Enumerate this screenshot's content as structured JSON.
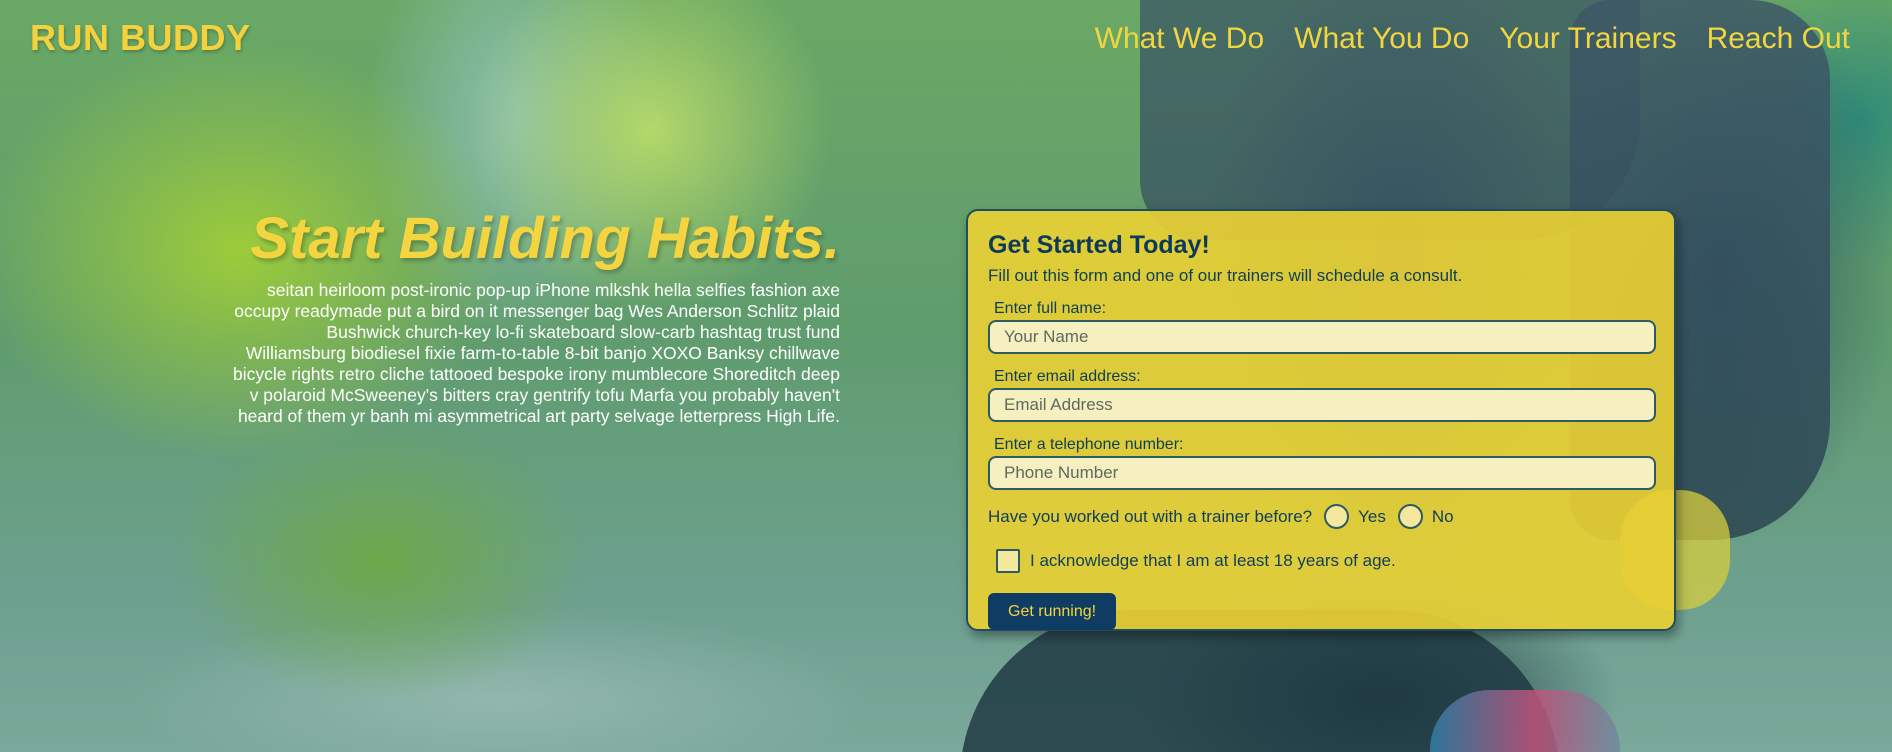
{
  "header": {
    "logo": "RUN BUDDY",
    "nav": [
      {
        "label": "What We Do"
      },
      {
        "label": "What You Do"
      },
      {
        "label": "Your Trainers"
      },
      {
        "label": "Reach Out"
      }
    ]
  },
  "hero": {
    "title": "Start Building Habits.",
    "body_lines": [
      "seitan heirloom post-ironic pop-up iPhone mlkshk hella selfies fashion axe",
      "occupy readymade put a bird on it messenger bag Wes Anderson Schlitz plaid",
      "Bushwick church-key lo-fi skateboard slow-carb hashtag trust fund",
      "Williamsburg biodiesel fixie farm-to-table 8-bit banjo XOXO Banksy chillwave",
      "bicycle rights retro cliche tattooed bespoke irony mumblecore Shoreditch deep",
      "v polaroid McSweeney's bitters cray gentrify tofu Marfa you probably haven't",
      "heard of them yr banh mi asymmetrical art party selvage letterpress High Life."
    ]
  },
  "form": {
    "title": "Get Started Today!",
    "subtitle": "Fill out this form and one of our trainers will schedule a consult.",
    "name": {
      "label": "Enter full name:",
      "placeholder": "Your Name",
      "value": ""
    },
    "email": {
      "label": "Enter email address:",
      "placeholder": "Email Address",
      "value": ""
    },
    "phone": {
      "label": "Enter a telephone number:",
      "placeholder": "Phone Number",
      "value": ""
    },
    "trainer_question": "Have you worked out with a trainer before?",
    "radio_yes": "Yes",
    "radio_no": "No",
    "acknowledge": "I acknowledge that I am at least 18 years of age.",
    "submit": "Get running!"
  },
  "colors": {
    "accent_yellow": "#f4d23d",
    "navy": "#0f3c63",
    "form_bg": "#e8cf34"
  }
}
